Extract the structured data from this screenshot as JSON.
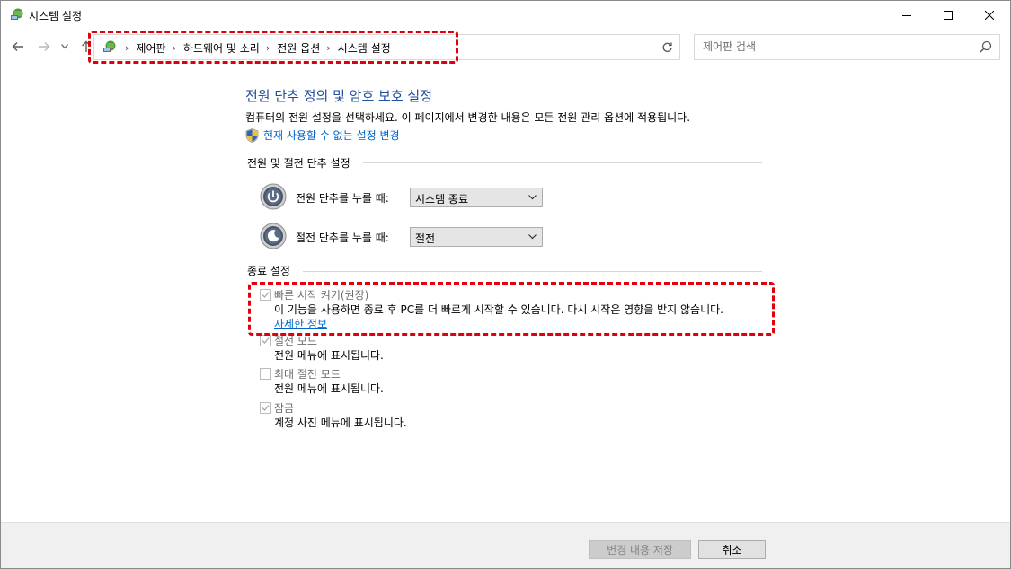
{
  "window": {
    "title": "시스템 설정"
  },
  "breadcrumb": [
    "제어판",
    "하드웨어 및 소리",
    "전원 옵션",
    "시스템 설정"
  ],
  "search": {
    "placeholder": "제어판 검색"
  },
  "main": {
    "title": "전원 단추 정의 및 암호 보호 설정",
    "description": "컴퓨터의 전원 설정을 선택하세요. 이 페이지에서 변경한 내용은 모든 전원 관리 옵션에 적용됩니다.",
    "uac_link": "현재 사용할 수 없는 설정 변경"
  },
  "power_section": {
    "heading": "전원 및 절전 단추 설정",
    "rows": [
      {
        "label": "전원 단추를 누를 때:",
        "value": "시스템 종료"
      },
      {
        "label": "절전 단추를 누를 때:",
        "value": "절전"
      }
    ]
  },
  "shutdown_section": {
    "heading": "종료 설정",
    "options": [
      {
        "label": "빠른 시작 켜기(권장)",
        "desc": "이 기능을 사용하면 종료 후 PC를 더 빠르게 시작할 수 있습니다. 다시 시작은 영향을 받지 않습니다.",
        "link": "자세한 정보",
        "checked": true
      },
      {
        "label": "절전 모드",
        "desc": "전원 메뉴에 표시됩니다.",
        "checked": true
      },
      {
        "label": "최대 절전 모드",
        "desc": "전원 메뉴에 표시됩니다.",
        "checked": false
      },
      {
        "label": "잠금",
        "desc": "계정 사진 메뉴에 표시됩니다.",
        "checked": true
      }
    ]
  },
  "footer": {
    "save_label": "변경 내용 저장",
    "cancel_label": "취소"
  },
  "colors": {
    "title": "#1e4e9c",
    "link": "#0066cc",
    "highlight": "#e0000c"
  },
  "icons": [
    "control-panel-icon",
    "back-arrow-icon",
    "forward-arrow-icon",
    "up-arrow-icon",
    "refresh-icon",
    "search-icon",
    "shield-icon",
    "power-button-icon",
    "sleep-button-icon"
  ]
}
